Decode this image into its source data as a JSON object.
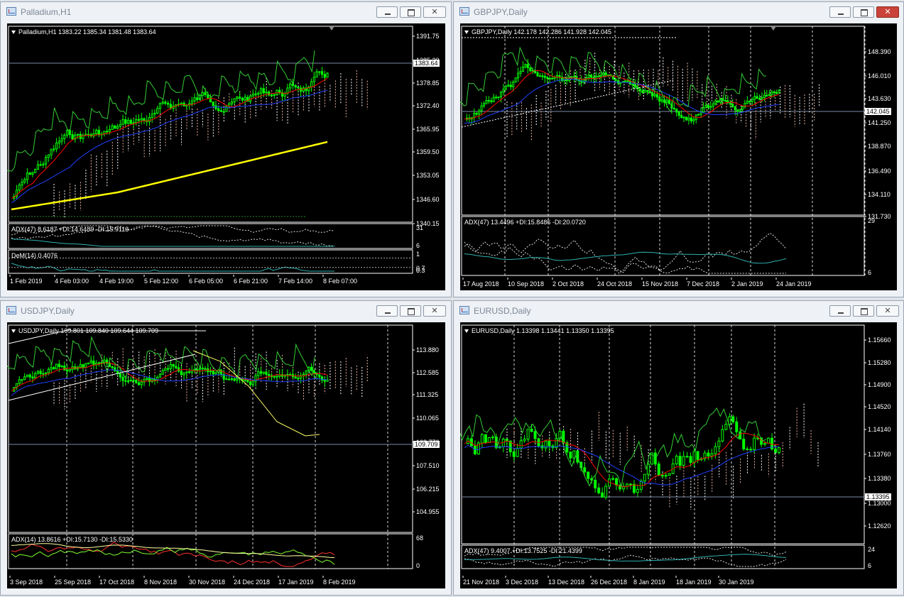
{
  "windows": [
    {
      "title": "Palladium,H1",
      "close_active": false,
      "chart": {
        "header": "Palladium,H1  1383.22 1385.34 1381.48 1383.64",
        "current_price": "1383.64",
        "price_ticks": [
          "1391.75",
          "1385.30",
          "1378.85",
          "1372.40",
          "1365.95",
          "1359.50",
          "1353.05",
          "1346.60",
          "1340.15"
        ],
        "indicators": [
          {
            "label": "ADX(47) 8.6187 +DI:14.6489 -DI:15.9113",
            "ticks": [
              "31",
              "6"
            ]
          },
          {
            "label": "DeM(14) 0.4076",
            "ticks": [
              "1",
              "0.7",
              "0.3",
              "0"
            ]
          }
        ],
        "time_labels": [
          "1 Feb 2019",
          "4 Feb 03:00",
          "4 Feb 19:00",
          "5 Feb 12:00",
          "6 Feb 05:00",
          "6 Feb 21:00",
          "7 Feb 14:00",
          "8 Feb 07:00"
        ]
      }
    },
    {
      "title": "GBPJPY,Daily",
      "close_active": true,
      "chart": {
        "header": "GBPJPY,Daily  142.178 142.286 141.928 142.045",
        "current_price": "142.045",
        "price_ticks": [
          "148.390",
          "146.010",
          "143.630",
          "141.250",
          "138.870",
          "136.490",
          "134.110",
          "131.730"
        ],
        "indicators": [
          {
            "label": "ADX(47) 13.4496 +DI:15.8486 -DI:20.0720",
            "ticks": [
              "29",
              "6"
            ]
          }
        ],
        "time_labels": [
          "17 Aug 2018",
          "10 Sep 2018",
          "2 Oct 2018",
          "24 Oct 2018",
          "15 Nov 2018",
          "7 Dec 2018",
          "2 Jan 2019",
          "24 Jan 2019"
        ]
      }
    },
    {
      "title": "USDJPY,Daily",
      "close_active": false,
      "chart": {
        "header": "USDJPY,Daily  109.801 109.840 109.644 109.709",
        "current_price": "109.709",
        "price_ticks": [
          "113.880",
          "112.585",
          "111.325",
          "110.065",
          "108.770",
          "107.510",
          "106.215",
          "104.955"
        ],
        "indicators": [
          {
            "label": "ADX(14) 13.8616 +DI:15.7130 -DI:15.5330",
            "ticks": [
              "68",
              "0"
            ]
          }
        ],
        "time_labels": [
          "3 Sep 2018",
          "25 Sep 2018",
          "17 Oct 2018",
          "8 Nov 2018",
          "30 Nov 2018",
          "24 Dec 2018",
          "17 Jan 2019",
          "8 Feb 2019"
        ]
      }
    },
    {
      "title": "EURUSD,Daily",
      "close_active": false,
      "chart": {
        "header": "EURUSD,Daily  1.13398 1.13441 1.13350 1.13395",
        "current_price": "1.13395",
        "price_ticks": [
          "1.15660",
          "1.15280",
          "1.14900",
          "1.14520",
          "1.14140",
          "1.13760",
          "1.13380",
          "1.13000",
          "1.12620"
        ],
        "indicators": [
          {
            "label": "ADX(47) 9.4007 +DI:13.7525 -DI:21.4399",
            "ticks": [
              "24",
              "6"
            ]
          }
        ],
        "time_labels": [
          "21 Nov 2018",
          "3 Dec 2018",
          "13 Dec 2018",
          "26 Dec 2018",
          "8 Jan 2019",
          "18 Jan 2019",
          "30 Jan 2019"
        ]
      }
    }
  ],
  "colors": {
    "chart_bg": "#000000",
    "candle": "#00ff00",
    "tenkan": "#ff0000",
    "kijun": "#0000ff",
    "chikou": "#33cc33",
    "ma200": "#ffff00",
    "adx_main": "#30b0b0",
    "grid": "#ffffff"
  }
}
